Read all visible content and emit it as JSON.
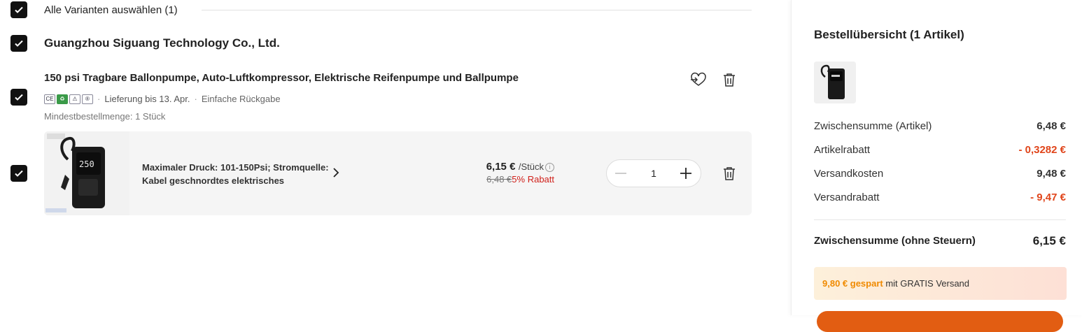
{
  "select_all": {
    "label": "Alle Varianten auswählen (1)"
  },
  "store": {
    "name": "Guangzhou Siguang Technology Co., Ltd."
  },
  "product": {
    "title": "150 psi Tragbare Ballonpumpe, Auto-Luftkompressor, Elektrische Reifenpumpe und Ballpumpe",
    "cert_marks": [
      "CE",
      "♻",
      "⚠",
      "®"
    ],
    "delivery": "Lieferung bis 13. Apr.",
    "returns": "Einfache Rückgabe",
    "separator": "·",
    "min_order": "Mindestbestellmenge: 1 Stück",
    "wishlist_icon": "heart-arrow-icon",
    "delete_icon": "trash-icon"
  },
  "variant": {
    "description": "Maximaler Druck: 101-150Psi; Stromquelle: Kabel geschnordtes elektrisches",
    "image_display": "250",
    "price_now": "6,15 €",
    "price_unit": "/Stück",
    "price_old": "6,48 €",
    "discount": "5% Rabatt",
    "quantity": "1"
  },
  "summary": {
    "title": "Bestellübersicht (1 Artikel)",
    "rows": [
      {
        "label": "Zwischensumme (Artikel)",
        "value": "6,48 €",
        "highlight": false
      },
      {
        "label": "Artikelrabatt",
        "value": "- 0,3282 €",
        "highlight": true
      },
      {
        "label": "Versandkosten",
        "value": "9,48 €",
        "highlight": false
      },
      {
        "label": "Versandrabatt",
        "value": "- 9,47 €",
        "highlight": true
      }
    ],
    "total_label": "Zwischensumme (ohne Steuern)",
    "total_value": "6,15 €",
    "saved_amount": "9,80 € gespart",
    "saved_text": " mit GRATIS Versand"
  },
  "colors": {
    "accent": "#e0451b",
    "discount_red": "#d0201a",
    "saved_orange": "#f08a00",
    "cta": "#e25d12"
  }
}
